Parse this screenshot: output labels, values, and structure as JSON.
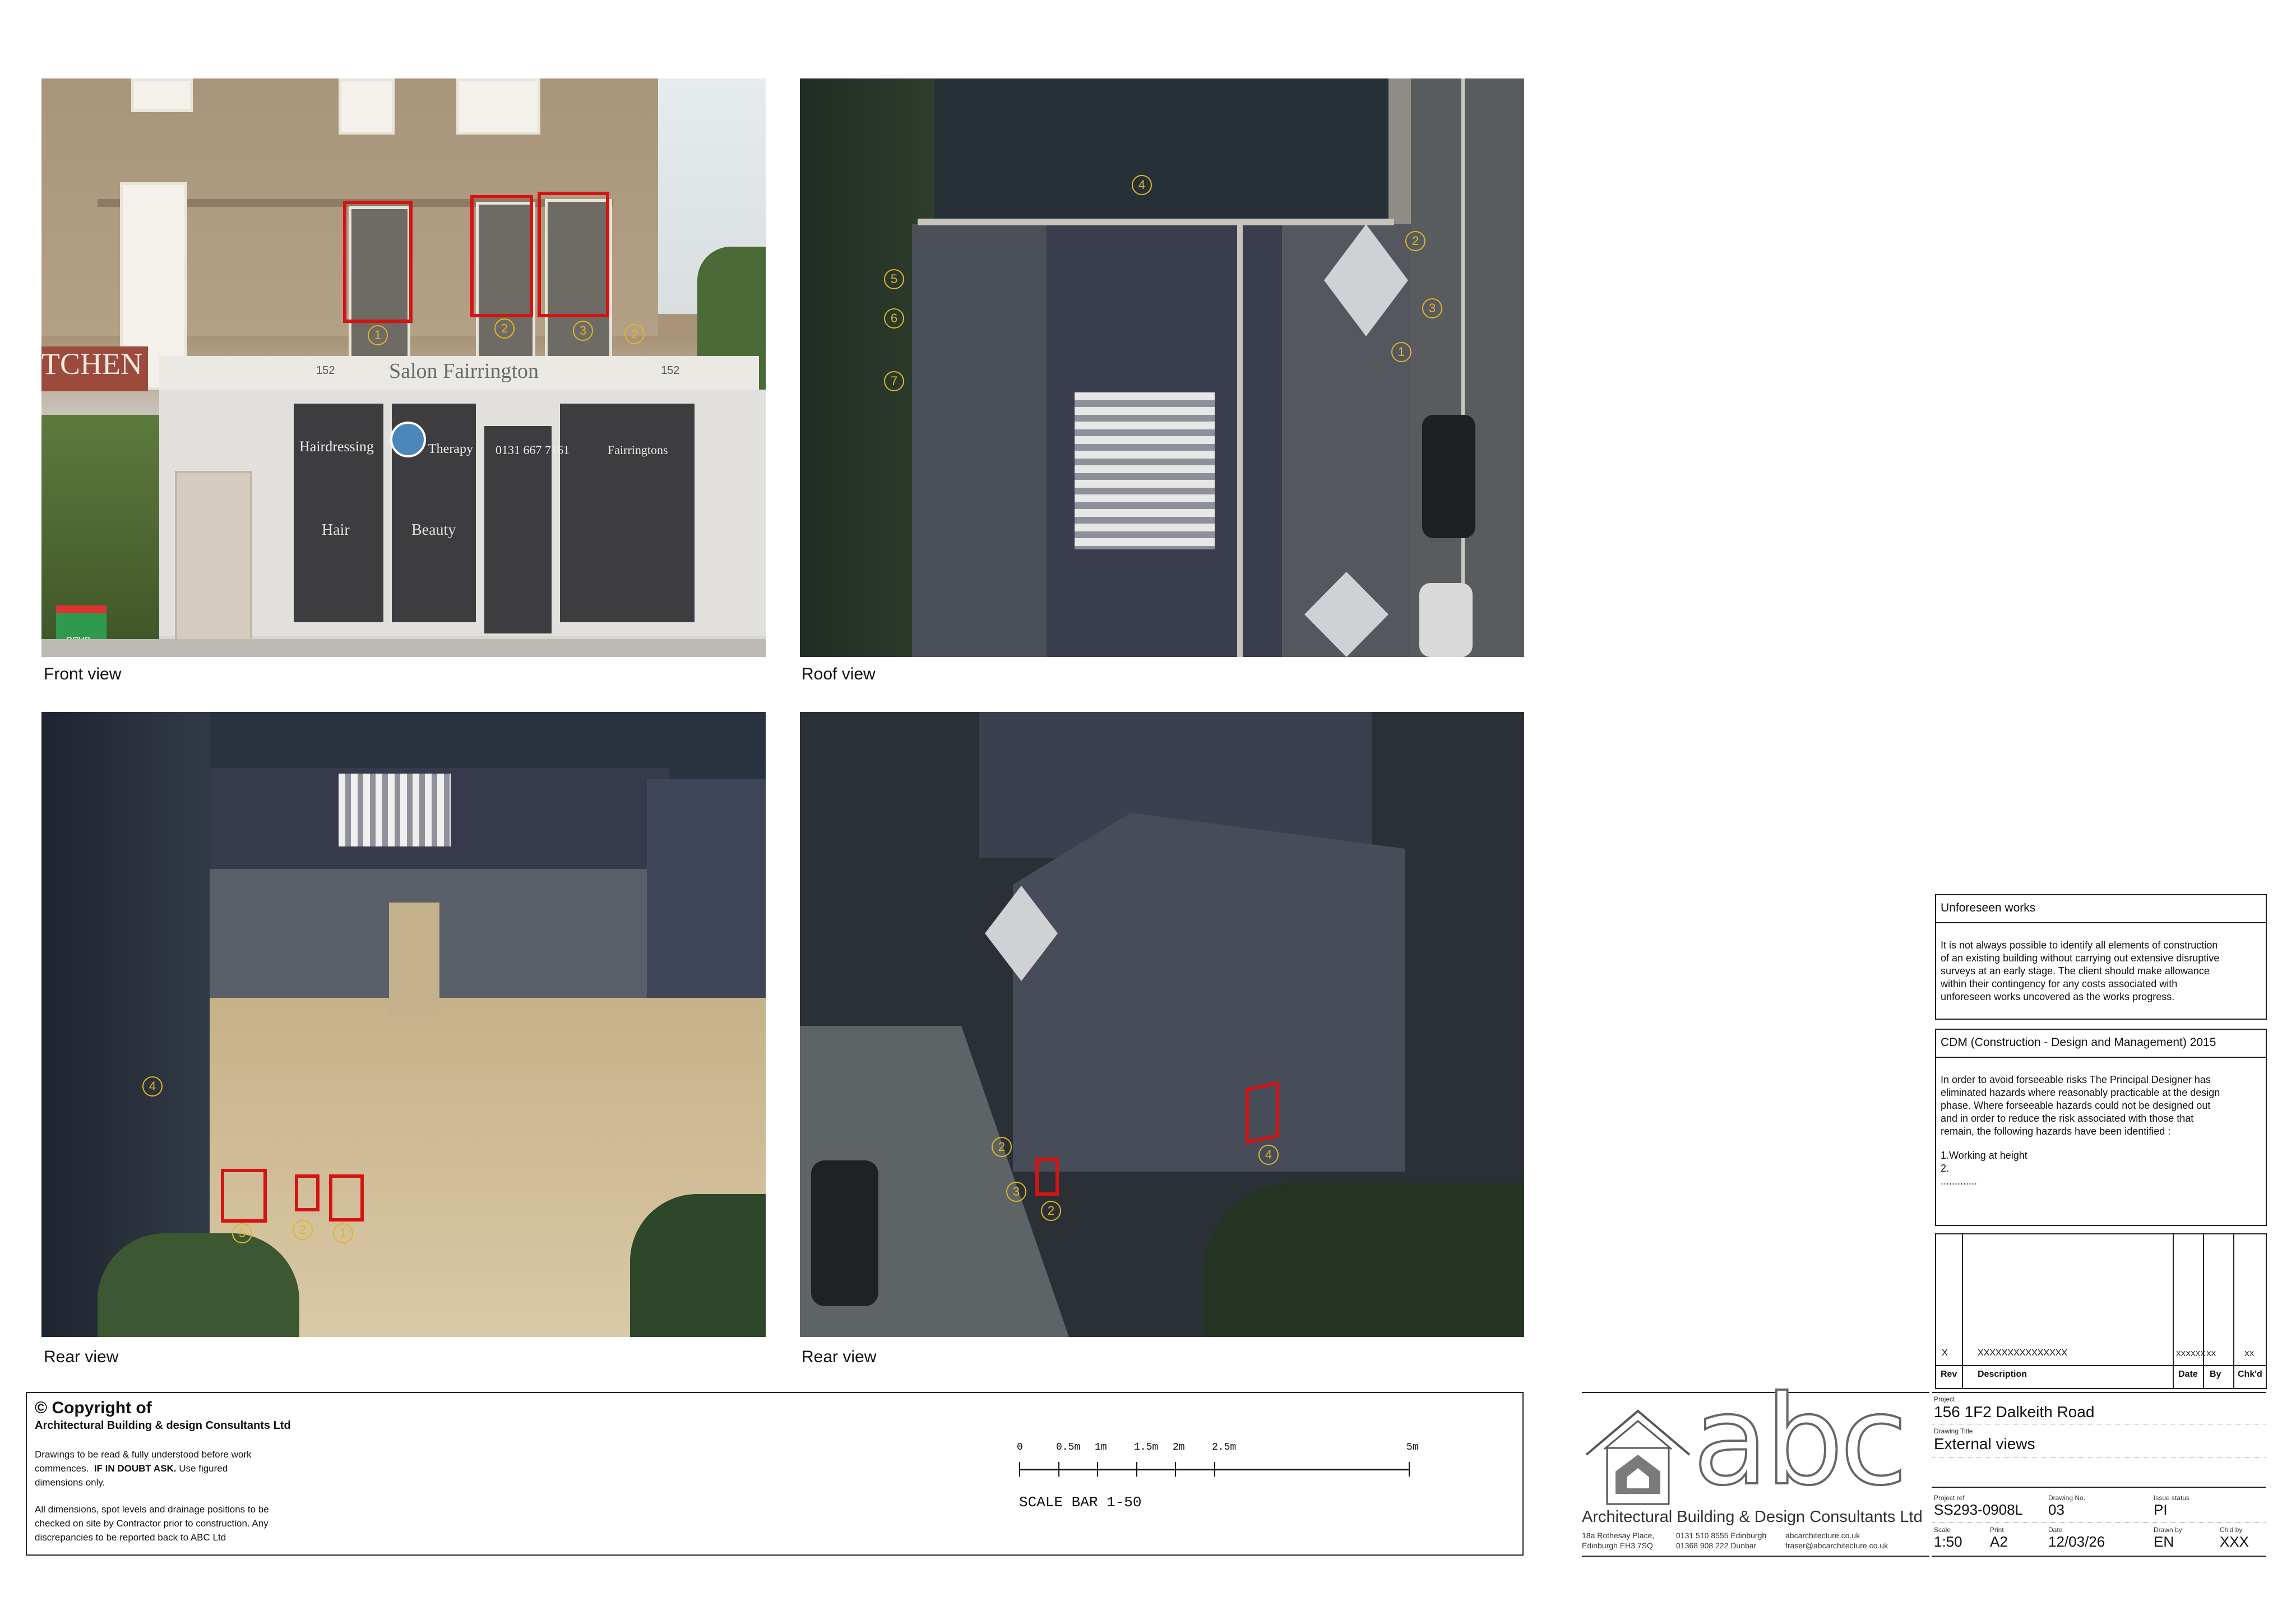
{
  "views": {
    "front": {
      "caption": "Front view",
      "shop_sign": "Salon Fairrington",
      "shop_sign_left": "TCHEN",
      "door_no_left": "152",
      "door_no_right": "152",
      "panel_1": "Hairdressing",
      "panel_2": "Therapy",
      "panel_3": "0131 667 7161",
      "panel_4": "Fairringtons",
      "window_1": "Hair",
      "window_2": "Beauty",
      "bin_label": "envo",
      "markers": [
        "1",
        "2",
        "3",
        "2"
      ]
    },
    "roof": {
      "caption": "Roof view",
      "markers": [
        "4",
        "2",
        "3",
        "5",
        "6",
        "7",
        "1"
      ]
    },
    "rear1": {
      "caption": "Rear view",
      "markers": [
        "4",
        "5",
        "2",
        "1"
      ]
    },
    "rear2": {
      "caption": "Rear view",
      "markers": [
        "2",
        "3",
        "2",
        "4"
      ]
    }
  },
  "copyright": {
    "title": "© Copyright of",
    "company": "Architectural Building & design Consultants Ltd",
    "para1_a": "Drawings to be read & fully understood before work",
    "para1_b": "commences.",
    "para1_bold": "IF IN DOUBT ASK.",
    "para1_c": "Use figured",
    "para1_d": "dimensions only.",
    "para2_a": "All dimensions, spot levels and drainage positions to be",
    "para2_b": "checked on site by Contractor prior to construction. Any",
    "para2_c": "discrepancies to be reported back to ABC Ltd"
  },
  "scale_bar": {
    "label": "SCALE BAR 1-50",
    "ticks": [
      {
        "text": "0",
        "m": 0
      },
      {
        "text": "0.5m",
        "m": 0.5
      },
      {
        "text": "1m",
        "m": 1
      },
      {
        "text": "1.5m",
        "m": 1.5
      },
      {
        "text": "2m",
        "m": 2
      },
      {
        "text": "2.5m",
        "m": 2.5
      },
      {
        "text": "5m",
        "m": 5
      }
    ]
  },
  "unforeseen": {
    "title": "Unforeseen works",
    "lines": [
      "It is not always possible to identify all elements of construction",
      "of an existing building without carrying out extensive disruptive",
      "surveys at an early stage. The client should make allowance",
      "within their contingency for any costs associated with",
      "unforeseen works uncovered as the works progress."
    ]
  },
  "cdm": {
    "title": "CDM (Construction - Design and Management) 2015",
    "lines": [
      "In order to avoid forseeable risks The Principal Designer has",
      "eliminated hazards where reasonably practicable at the design",
      "phase. Where forseeable hazards could not be designed out",
      "and in order to reduce the risk associated with those that",
      "remain, the following hazards have been identified :"
    ],
    "hazards": [
      "1.Working at height",
      "2.",
      "............."
    ]
  },
  "revisions": {
    "headers": {
      "rev": "Rev",
      "desc": "Description",
      "date": "Date",
      "by": "By",
      "chkd": "Chk'd"
    },
    "row": {
      "rev": "X",
      "desc": "XXXXXXXXXXXXXXX",
      "date": "XXXXXX",
      "by": "XX",
      "chkd": "XX"
    }
  },
  "company": {
    "logo_text": "abc",
    "name": "Architectural Building & Design Consultants Ltd",
    "addr_1": "18a Rothesay Place,",
    "addr_2": "Edinburgh EH3 7SQ",
    "phone_1": "0131 510 8555 Edinburgh",
    "phone_2": "01368 908 222 Dunbar",
    "web": "abcarchitecture.co.uk",
    "email": "fraser@abcarchitecture.co.uk"
  },
  "title_block": {
    "project_label": "Project",
    "project": "156 1F2 Dalkeith Road",
    "drawing_title_label": "Drawing Title",
    "drawing_title": "External views",
    "project_ref_label": "Project ref",
    "project_ref": "SS293-0908L",
    "drawing_no_label": "Drawing No.",
    "drawing_no": "03",
    "issue_status_label": "Issue status",
    "issue_status": "PI",
    "scale_label": "Scale",
    "scale": "1:50",
    "print_label": "Print",
    "print": "A2",
    "date_label": "Date",
    "date": "12/03/26",
    "drawn_by_label": "Drawn by",
    "drawn_by": "EN",
    "chkd_by_label": "Ch'd  by",
    "chkd_by": "XXX"
  },
  "colors": {
    "markup_red": "#d41414",
    "marker_yellow": "#e0b62a",
    "roof_slate": "#3a3d4e"
  }
}
